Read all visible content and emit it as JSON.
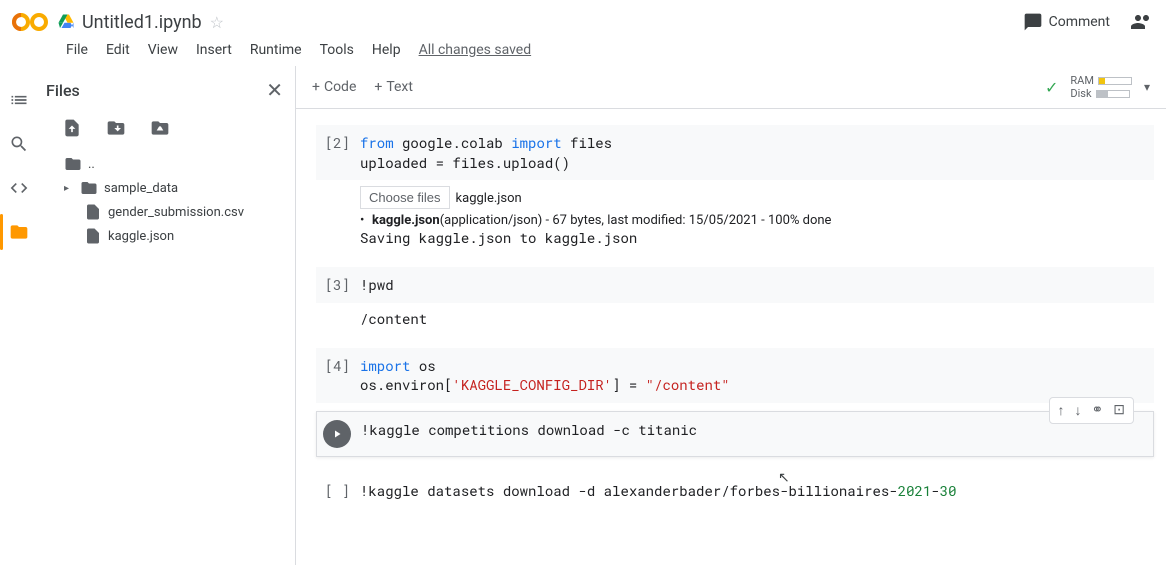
{
  "header": {
    "title": "Untitled1.ipynb",
    "comment_label": "Comment"
  },
  "menu": {
    "items": [
      "File",
      "Edit",
      "View",
      "Insert",
      "Runtime",
      "Tools",
      "Help"
    ],
    "save_status": "All changes saved"
  },
  "sidebar": {
    "title": "Files",
    "tree": {
      "parent": "..",
      "folder1": "sample_data",
      "file1": "gender_submission.csv",
      "file2": "kaggle.json"
    }
  },
  "toolbar": {
    "code_label": "Code",
    "text_label": "Text"
  },
  "resources": {
    "ram_label": "RAM",
    "disk_label": "Disk"
  },
  "cells": [
    {
      "exec": "[2]",
      "code_html": "<span class='kw'>from</span> google.colab <span class='kw'>import</span> files\nuploaded = files.upload()",
      "output": {
        "choose_btn": "Choose files",
        "chosen_file": "kaggle.json",
        "upload_bold": "kaggle.json",
        "upload_rest": "(application/json) - 67 bytes, last modified: 15/05/2021 - 100% done",
        "saving": "Saving kaggle.json to kaggle.json"
      }
    },
    {
      "exec": "[3]",
      "code_html": "!pwd",
      "output_text": "/content"
    },
    {
      "exec": "[4]",
      "code_html": "<span class='kw'>import</span> os\nos.environ[<span class='str'>'KAGGLE_CONFIG_DIR'</span>] = <span class='str'>\"/content\"</span>"
    },
    {
      "exec": "",
      "active": true,
      "code_html": "!kaggle competitions download -c titanic"
    },
    {
      "exec": "[ ]",
      "code_html": "!kaggle datasets download -d alexanderbader/forbes-billionaires-<span class='num'>2021</span>-<span class='num'>30</span>"
    }
  ]
}
